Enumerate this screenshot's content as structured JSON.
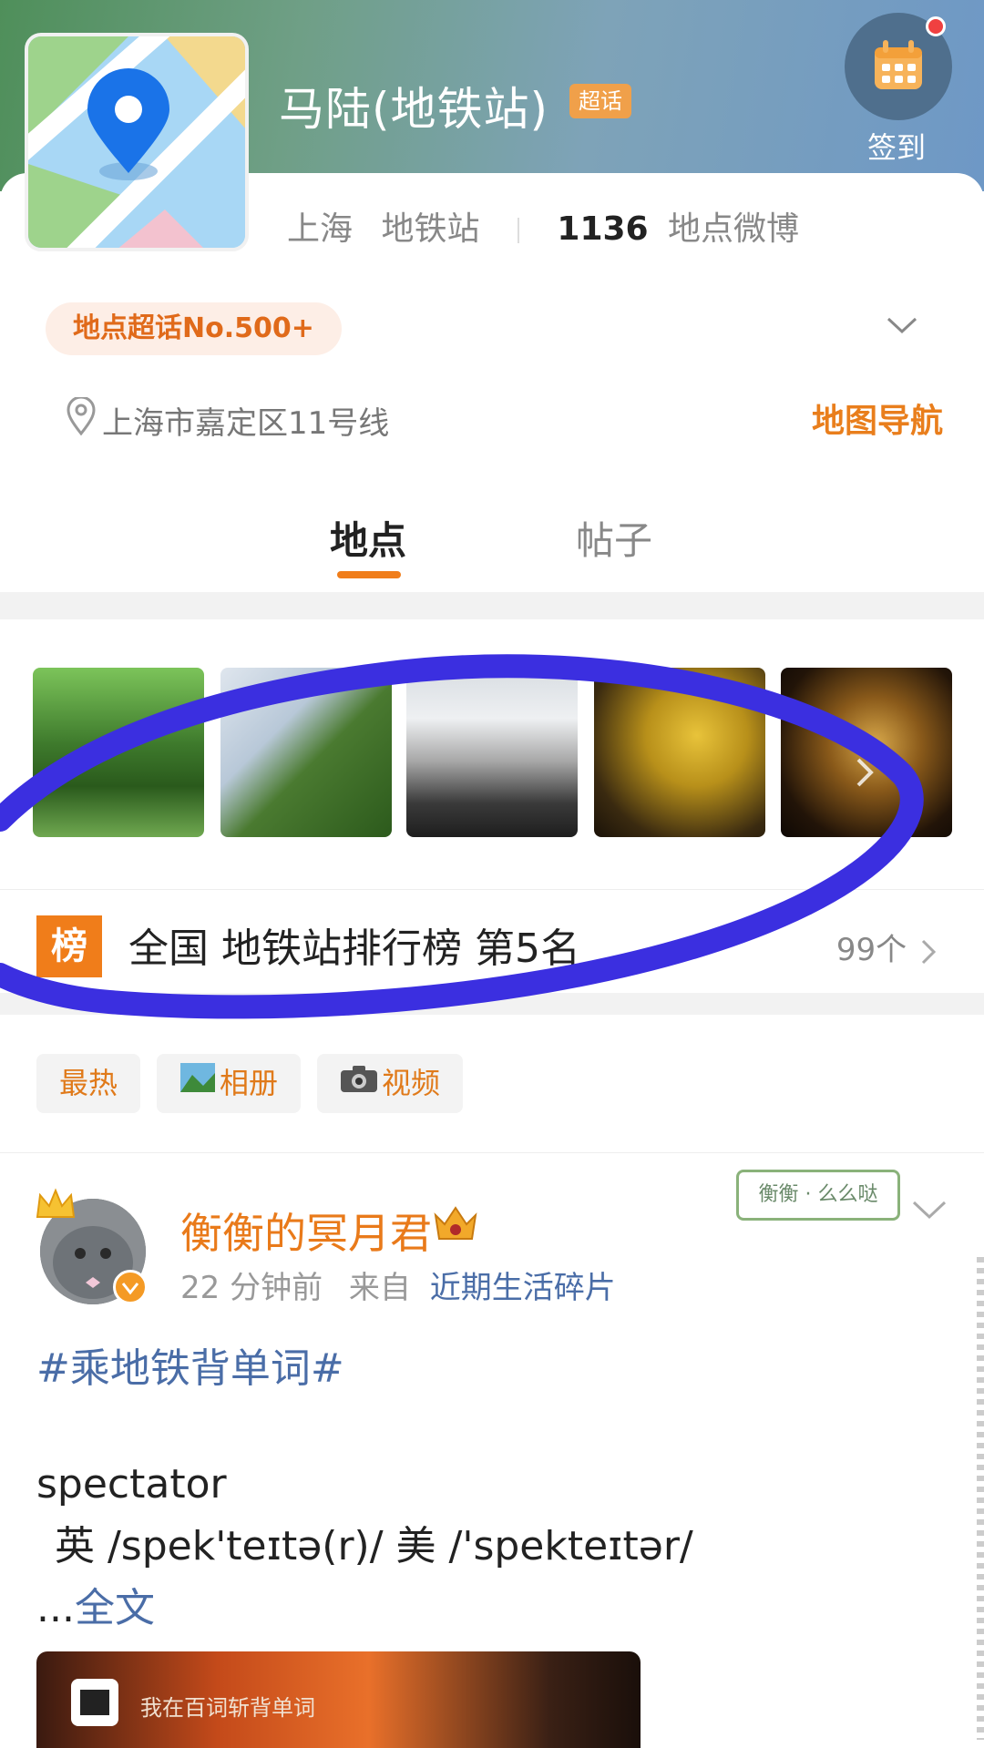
{
  "header": {
    "title": "马陆(地铁站)",
    "super_badge": "超话",
    "checkin_label": "签到",
    "city": "上海",
    "category": "地铁站",
    "post_count": "1136",
    "post_count_suffix": "地点微博"
  },
  "rank_pill": "地点超话No.500+",
  "location": {
    "address": "上海市嘉定区11号线",
    "nav_label": "地图导航"
  },
  "tabs": [
    {
      "label": "地点",
      "active": true
    },
    {
      "label": "帖子",
      "active": false
    }
  ],
  "leaderboard": {
    "icon_text": "榜",
    "text": "全国 地铁站排行榜 第5名",
    "count": "99个"
  },
  "filters": [
    {
      "label": "最热",
      "icon": ""
    },
    {
      "label": "相册",
      "icon": "photo-album-icon"
    },
    {
      "label": "视频",
      "icon": "camera-icon"
    }
  ],
  "post": {
    "username": "衡衡的冥月君",
    "time": "22 分钟前",
    "from_label": "来自",
    "source": "近期生活碎片",
    "stamp_text": "衡衡 · 么么哒",
    "hashtag": "#乘地铁背单词#",
    "word": "spectator",
    "phonetic": "英 /spek'teɪtə(r)/  美 /'spekteɪtər/",
    "ellipsis": "...",
    "more_label": "全文",
    "video_label": "我在百词斩背单词"
  },
  "colors": {
    "accent_orange": "#f07d1a",
    "link_blue": "#4a6da7",
    "annotation_blue": "#3b2fe0"
  }
}
